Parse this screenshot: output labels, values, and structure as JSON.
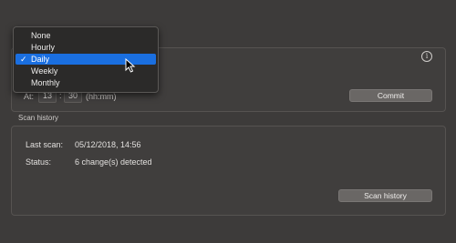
{
  "schedule": {
    "menu_items": [
      {
        "label": "None",
        "selected": false
      },
      {
        "label": "Hourly",
        "selected": false
      },
      {
        "label": "Daily",
        "selected": true
      },
      {
        "label": "Weekly",
        "selected": false
      },
      {
        "label": "Monthly",
        "selected": false
      }
    ],
    "check_mark": "✓",
    "at_label": "At:",
    "hour": "13",
    "minute": "30",
    "colon": ":",
    "time_hint": "(hh:mm)",
    "commit_label": "Commit",
    "info_icon": "i"
  },
  "scan_history": {
    "section_title": "Scan history",
    "last_scan_label": "Last scan:",
    "last_scan_value": "05/12/2018, 14:56",
    "status_label": "Status:",
    "status_value": "6 change(s) detected",
    "button_label": "Scan history"
  },
  "colors": {
    "background": "#3d3b3a",
    "selection": "#1a6fe0",
    "button": "#6a6765"
  }
}
